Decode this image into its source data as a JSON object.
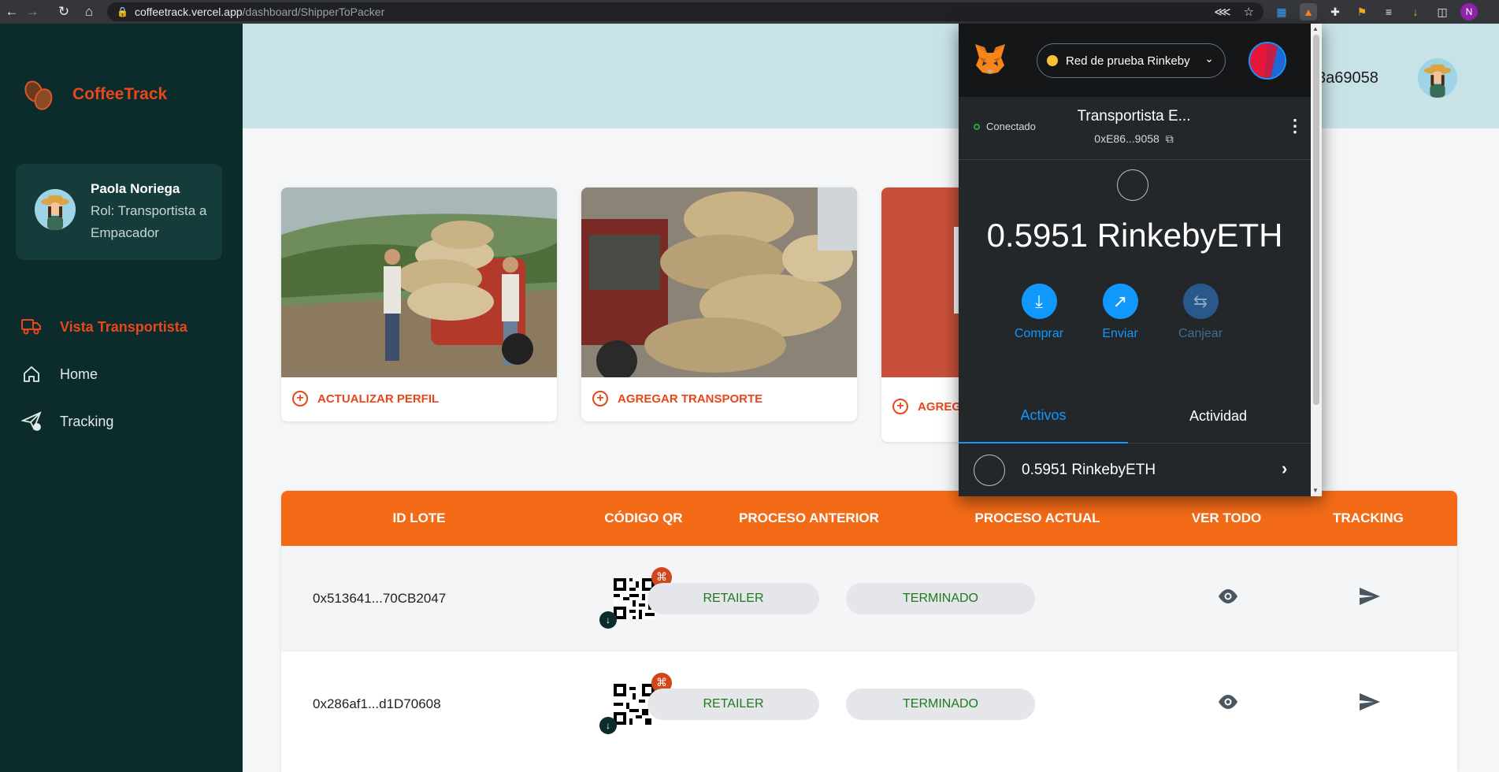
{
  "browser": {
    "url_host": "coffeetrack.vercel.app",
    "url_path": "/dashboard/ShipperToPacker",
    "profile_initial": "N"
  },
  "sidebar": {
    "brand": "CoffeeTrack",
    "profile": {
      "name": "Paola Noriega",
      "role": "Rol: Transportista a Empacador"
    },
    "menu": [
      {
        "label": "Vista Transportista",
        "icon": "truck-icon",
        "active": true
      },
      {
        "label": "Home",
        "icon": "home-icon",
        "active": false
      },
      {
        "label": "Tracking",
        "icon": "send-check-icon",
        "active": false
      }
    ]
  },
  "header": {
    "address_fragment": "3a69058"
  },
  "cards": [
    {
      "label": "ACTUALIZAR PERFIL"
    },
    {
      "label": "AGREGAR TRANSPORTE"
    },
    {
      "label": "AGREG"
    }
  ],
  "table": {
    "columns": [
      "ID LOTE",
      "CÓDIGO QR",
      "PROCESO ANTERIOR",
      "PROCESO ACTUAL",
      "VER TODO",
      "TRACKING"
    ],
    "rows": [
      {
        "id": "0x513641...70CB2047",
        "prev": "RETAILER",
        "curr": "TERMINADO"
      },
      {
        "id": "0x286af1...d1D70608",
        "prev": "RETAILER",
        "curr": "TERMINADO"
      }
    ]
  },
  "metamask": {
    "network": "Red de prueba Rinkeby",
    "status": "Conectado",
    "account_name": "Transportista E...",
    "account_address": "0xE86...9058",
    "balance": "0.5951 RinkebyETH",
    "actions": [
      {
        "label": "Comprar",
        "icon": "download-icon",
        "enabled": true
      },
      {
        "label": "Enviar",
        "icon": "arrow-up-right-icon",
        "enabled": true
      },
      {
        "label": "Canjear",
        "icon": "swap-icon",
        "enabled": false
      }
    ],
    "tabs": [
      "Activos",
      "Actividad"
    ],
    "asset": "0.5951 RinkebyETH"
  },
  "colors": {
    "sidebar": "#0c2b2b",
    "accent": "#e8471c",
    "table_header": "#f46b17",
    "metamask_blue": "#1098fc"
  }
}
